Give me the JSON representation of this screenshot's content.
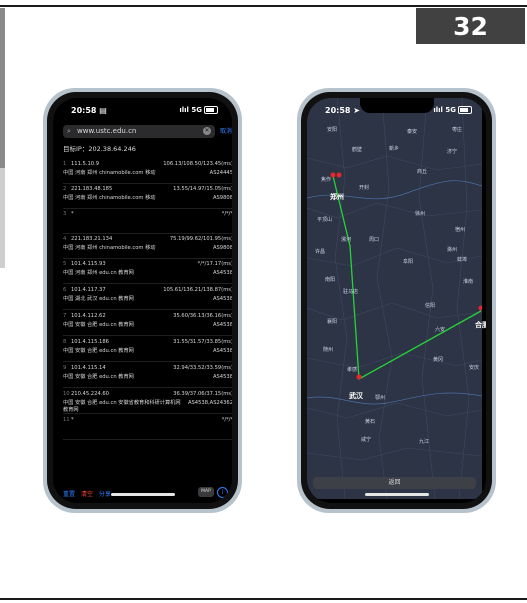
{
  "slide_number": "32",
  "left_phone": {
    "status": {
      "time": "20:58",
      "time_icon": "doc-icon",
      "network": "5G"
    },
    "search": {
      "query": "www.ustc.edu.cn",
      "cancel_label": "取消"
    },
    "target_ip": "目标IP：202.38.64.246",
    "hops": [
      {
        "no": "1",
        "ip": "111.5.10.9",
        "ms": "106.13/108.50/123.45(ms)",
        "location": "中国 河南 郑州 chinamobile.com 移动",
        "asn": "AS24445"
      },
      {
        "no": "2",
        "ip": "221.183.48.185",
        "ms": "13.55/14.97/15.05(ms)",
        "location": "中国 河南 郑州 chinamobile.com 移动",
        "asn": "AS9808"
      },
      {
        "no": "3",
        "ip": "*",
        "ms": "*/*/*",
        "location": "",
        "asn": ""
      },
      {
        "no": "4",
        "ip": "221.183.21.134",
        "ms": "75.19/99.62/101.95(ms)",
        "location": "中国 河南 郑州 chinamobile.com 移动",
        "asn": "AS9808"
      },
      {
        "no": "5",
        "ip": "101.4.115.93",
        "ms": "*/*/17.17(ms)",
        "location": "中国 河南 郑州 edu.cn 教育网",
        "asn": "AS4538"
      },
      {
        "no": "6",
        "ip": "101.4.117.37",
        "ms": "105.61/136.21/138.87(ms)",
        "location": "中国 湖北 武汉 edu.cn 教育网",
        "asn": "AS4538"
      },
      {
        "no": "7",
        "ip": "101.4.112.62",
        "ms": "35.60/36.13/36.16(ms)",
        "location": "中国 安徽 合肥 edu.cn 教育网",
        "asn": "AS4538"
      },
      {
        "no": "8",
        "ip": "101.4.115.186",
        "ms": "31.55/31.57/33.85(ms)",
        "location": "中国 安徽 合肥 edu.cn 教育网",
        "asn": "AS4538"
      },
      {
        "no": "9",
        "ip": "101.4.115.14",
        "ms": "32.94/33.52/33.59(ms)",
        "location": "中国 安徽 合肥 edu.cn 教育网",
        "asn": "AS4538"
      },
      {
        "no": "10",
        "ip": "210.45.224.60",
        "ms": "36.39/37.06/37.15(ms)",
        "location": "中国 安徽 合肥 edu.cn 安徽省教育和科研计算机网教育网",
        "asn": "AS4538,AS24362"
      },
      {
        "no": "11",
        "ip": "*",
        "ms": "*/*/*",
        "location": "",
        "asn": ""
      }
    ],
    "bottom": {
      "btn1": "重置",
      "btn2": "清空",
      "btn3": "分享",
      "map_label": "MAP",
      "info_symbol": "i"
    }
  },
  "right_phone": {
    "status": {
      "time": "20:58",
      "network": "5G"
    },
    "cities": {
      "zhengzhou": "郑州",
      "wuhan": "武汉",
      "hefei": "合肥"
    },
    "map_labels": [
      "安阳",
      "鹤壁",
      "新乡",
      "焦作",
      "开封",
      "商丘",
      "济宁",
      "徐州",
      "宿州",
      "蚌埠",
      "淮南",
      "平顶山",
      "漯河",
      "周口",
      "阜阳",
      "南阳",
      "驻马店",
      "信阳",
      "六安",
      "随州",
      "孝感",
      "黄冈",
      "安庆",
      "鄂州",
      "黄石",
      "咸宁",
      "九江",
      "枣庄",
      "泰安",
      "滁州",
      "许昌",
      "襄阳"
    ],
    "back_label": "返回"
  },
  "colors": {
    "route": "#27d23a",
    "marker": "#e8262e",
    "map_bg": "#2c3445"
  }
}
